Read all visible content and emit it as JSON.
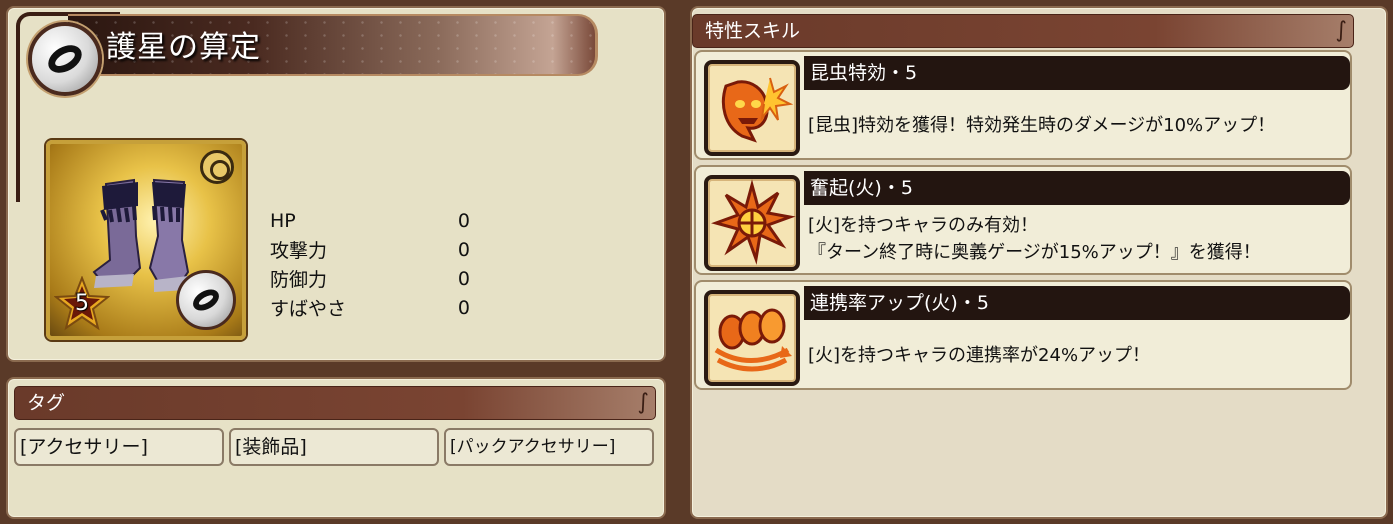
{
  "item": {
    "name": "護星の算定",
    "rarity": "5",
    "emblem_icon": "ring-emblem-icon",
    "item_icon": "boots-icon"
  },
  "stats": [
    {
      "label": "HP",
      "value": "0"
    },
    {
      "label": "攻撃力",
      "value": "0"
    },
    {
      "label": "防御力",
      "value": "0"
    },
    {
      "label": "すばやさ",
      "value": "0"
    }
  ],
  "tags": {
    "header": "タグ",
    "items": [
      "[アクセサリー]",
      "[装飾品]",
      "[パックアクセサリー]"
    ]
  },
  "skills": {
    "header": "特性スキル",
    "items": [
      {
        "name": "昆虫特効・5",
        "icon": "demon-flame-icon",
        "desc1": "[昆虫]特効を獲得！特効発生時のダメージが10%アップ！",
        "desc2": ""
      },
      {
        "name": "奮起(火)・5",
        "icon": "fire-burst-icon",
        "desc1": "[火]を持つキャラのみ有効！",
        "desc2": "『ターン終了時に奥義ゲージが15%アップ！』を獲得！"
      },
      {
        "name": "連携率アップ(火)・5",
        "icon": "fire-combo-icon",
        "desc1": "[火]を持つキャラの連携率が24%アップ！",
        "desc2": ""
      }
    ]
  },
  "colors": {
    "panel": "#e6e1c6",
    "header": "#7a4432",
    "skill_bar": "#231510",
    "fire_orange": "#e86818"
  }
}
